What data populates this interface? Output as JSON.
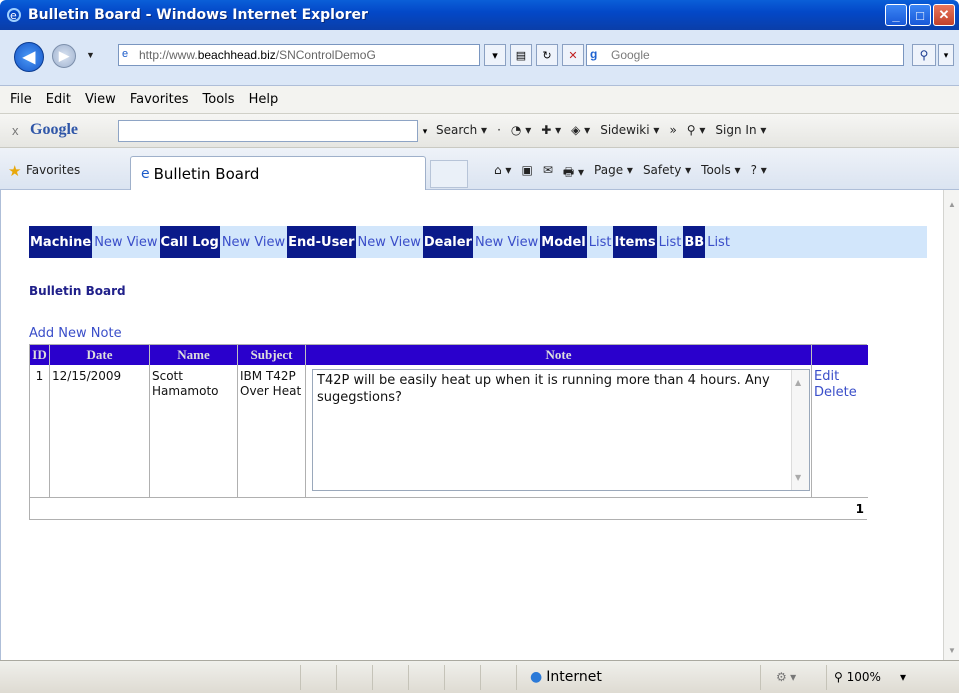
{
  "window": {
    "title": "Bulletin Board - Windows Internet Explorer",
    "min": "_",
    "max": "□",
    "close": "✕"
  },
  "address": {
    "url_prefix": "http://www.",
    "url_domain": "beachhead.biz",
    "url_rest": "/SNControlDemoG",
    "search_placeholder": "Google"
  },
  "menu": [
    "File",
    "Edit",
    "View",
    "Favorites",
    "Tools",
    "Help"
  ],
  "google_toolbar": {
    "close": "x",
    "label": "Google",
    "items": [
      "Search ▾",
      "·",
      "◔ ▾",
      "✚ ▾",
      "◈ ▾",
      "Sidewiki ▾",
      "»",
      "⚲ ▾",
      "Sign In ▾"
    ]
  },
  "favorites": {
    "label": "Favorites",
    "tab_title": "Bulletin Board",
    "commands": [
      "⌂ ▾",
      "▣",
      "✉",
      "🖶 ▾",
      "Page ▾",
      "Safety ▾",
      "Tools ▾",
      "? ▾"
    ]
  },
  "nav": [
    {
      "text": "Machine",
      "style": "dark"
    },
    {
      "text": "New View",
      "style": "light"
    },
    {
      "text": "Call Log",
      "style": "dark"
    },
    {
      "text": "New View",
      "style": "light"
    },
    {
      "text": "End-User",
      "style": "dark"
    },
    {
      "text": "New View",
      "style": "light"
    },
    {
      "text": "Dealer",
      "style": "dark"
    },
    {
      "text": "New View",
      "style": "light"
    },
    {
      "text": "Model",
      "style": "dark"
    },
    {
      "text": "List",
      "style": "light"
    },
    {
      "text": "Items",
      "style": "dark"
    },
    {
      "text": "List",
      "style": "light"
    },
    {
      "text": "BB",
      "style": "dark"
    },
    {
      "text": "List",
      "style": "light"
    }
  ],
  "page": {
    "title": "Bulletin Board",
    "add_new_note": "Add New Note"
  },
  "grid": {
    "columns": [
      "ID",
      "Date",
      "Name",
      "Subject",
      "Note",
      ""
    ],
    "rows": [
      {
        "id": "1",
        "date": "12/15/2009",
        "name": "Scott Hamamoto",
        "subject": "IBM T42P Over Heat",
        "note": "T42P will be easily heat up when it is running more than 4 hours. Any sugegstions?",
        "edit": "Edit",
        "delete": "Delete"
      }
    ],
    "pager": "1"
  },
  "status": {
    "zone": "Internet",
    "zoom": "100%",
    "zoom_drop": "▾"
  }
}
